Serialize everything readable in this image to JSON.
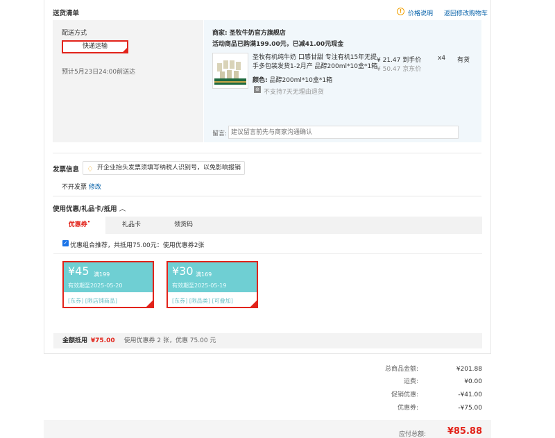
{
  "header": {
    "title": "送货清单",
    "price_info_icon": "info-circle-icon",
    "price_info_label": "价格说明",
    "back_to_cart_label": "返回修改购物车"
  },
  "shipping": {
    "label": "配送方式",
    "method": "快递运输",
    "estimate": "预计5月23日24:00前送达"
  },
  "merchant": {
    "prefix": "商家:",
    "name": "圣牧牛奶官方旗舰店",
    "promo": "活动商品已购满199.00元，已减41.00元现金"
  },
  "product": {
    "title_line1": "圣牧有机纯牛奶 口感甘甜 专注有机15年无提",
    "title_line2": "手多包装发货1-2月产 品醇200ml*10盒*1箱",
    "price": "¥ 21.47 到手价",
    "orig_price": "¥ 50.47 京东价",
    "qty": "x4",
    "stock": "有货",
    "color_label": "颜色:",
    "color_value": "品醇200ml*10盒*1箱",
    "return_policy": "不支持7天无理由退货"
  },
  "remark": {
    "label": "留言:",
    "placeholder": "建议留言前先与商家沟通确认"
  },
  "invoice": {
    "title": "发票信息",
    "tip": "开企业抬头发票须填写纳税人识别号，以免影响报销",
    "status": "不开发票",
    "edit": "修改"
  },
  "discounts": {
    "title": "使用优惠/礼品卡/抵用",
    "tabs": [
      "优惠券",
      "礼品卡",
      "领货码"
    ],
    "recommend": "优惠组合推荐，共抵用75.00元：使用优惠券2张",
    "coupons": [
      {
        "amount": "¥45",
        "condition": "满199",
        "expiry": "有效期至2025-05-20",
        "tags": "[东券]  [限店铺商品]"
      },
      {
        "amount": "¥30",
        "condition": "满169",
        "expiry": "有效期至2025-05-19",
        "tags": "[东券]  [限品类]  [可叠加]"
      }
    ],
    "summary_label": "金额抵用",
    "summary_amount": "¥75.00",
    "summary_detail": "使用优惠券 2 张，优惠 75.00 元"
  },
  "totals": {
    "rows": [
      {
        "label": "总商品金额:",
        "value": "¥201.88"
      },
      {
        "label": "运费:",
        "value": "¥0.00"
      },
      {
        "label": "促销优惠:",
        "value": "-¥41.00"
      },
      {
        "label": "优惠券:",
        "value": "-¥75.00"
      }
    ],
    "payable_label": "应付总额:",
    "payable_value": "¥85.88"
  },
  "colors": {
    "accent": "#e2231a",
    "coupon": "#6fcfd3",
    "link": "#005ea7"
  }
}
